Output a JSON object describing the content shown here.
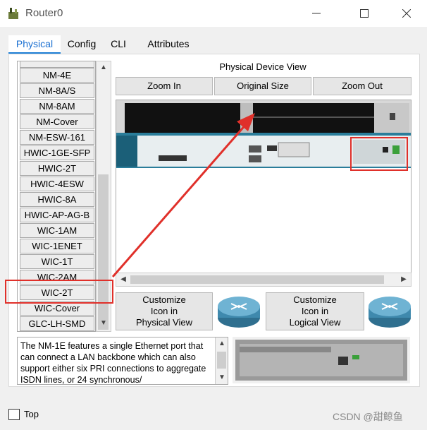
{
  "window": {
    "title": "Router0"
  },
  "tabs": [
    {
      "label": "Physical"
    },
    {
      "label": "Config"
    },
    {
      "label": "CLI"
    },
    {
      "label": "Attributes"
    }
  ],
  "modules": [
    "NM-4E",
    "NM-8A/S",
    "NM-8AM",
    "NM-Cover",
    "NM-ESW-161",
    "HWIC-1GE-SFP",
    "HWIC-2T",
    "HWIC-4ESW",
    "HWIC-8A",
    "HWIC-AP-AG-B",
    "WIC-1AM",
    "WIC-1ENET",
    "WIC-1T",
    "WIC-2AM",
    "WIC-2T",
    "WIC-Cover",
    "GLC-LH-SMD"
  ],
  "device_view": {
    "title": "Physical Device View",
    "zoom_in": "Zoom In",
    "original_size": "Original Size",
    "zoom_out": "Zoom Out"
  },
  "customize": {
    "physical": [
      "Customize",
      "Icon in",
      "Physical View"
    ],
    "logical": [
      "Customize",
      "Icon in",
      "Logical View"
    ]
  },
  "description": "The NM-1E features a single Ethernet port that can connect a LAN backbone which can also support either six PRI connections to aggregate ISDN lines, or 24 synchronous/",
  "footer": {
    "top_label": "Top",
    "watermark": "CSDN @甜鲸鱼"
  },
  "colors": {
    "accent": "#1e7fd6",
    "highlight": "#e0302a"
  }
}
